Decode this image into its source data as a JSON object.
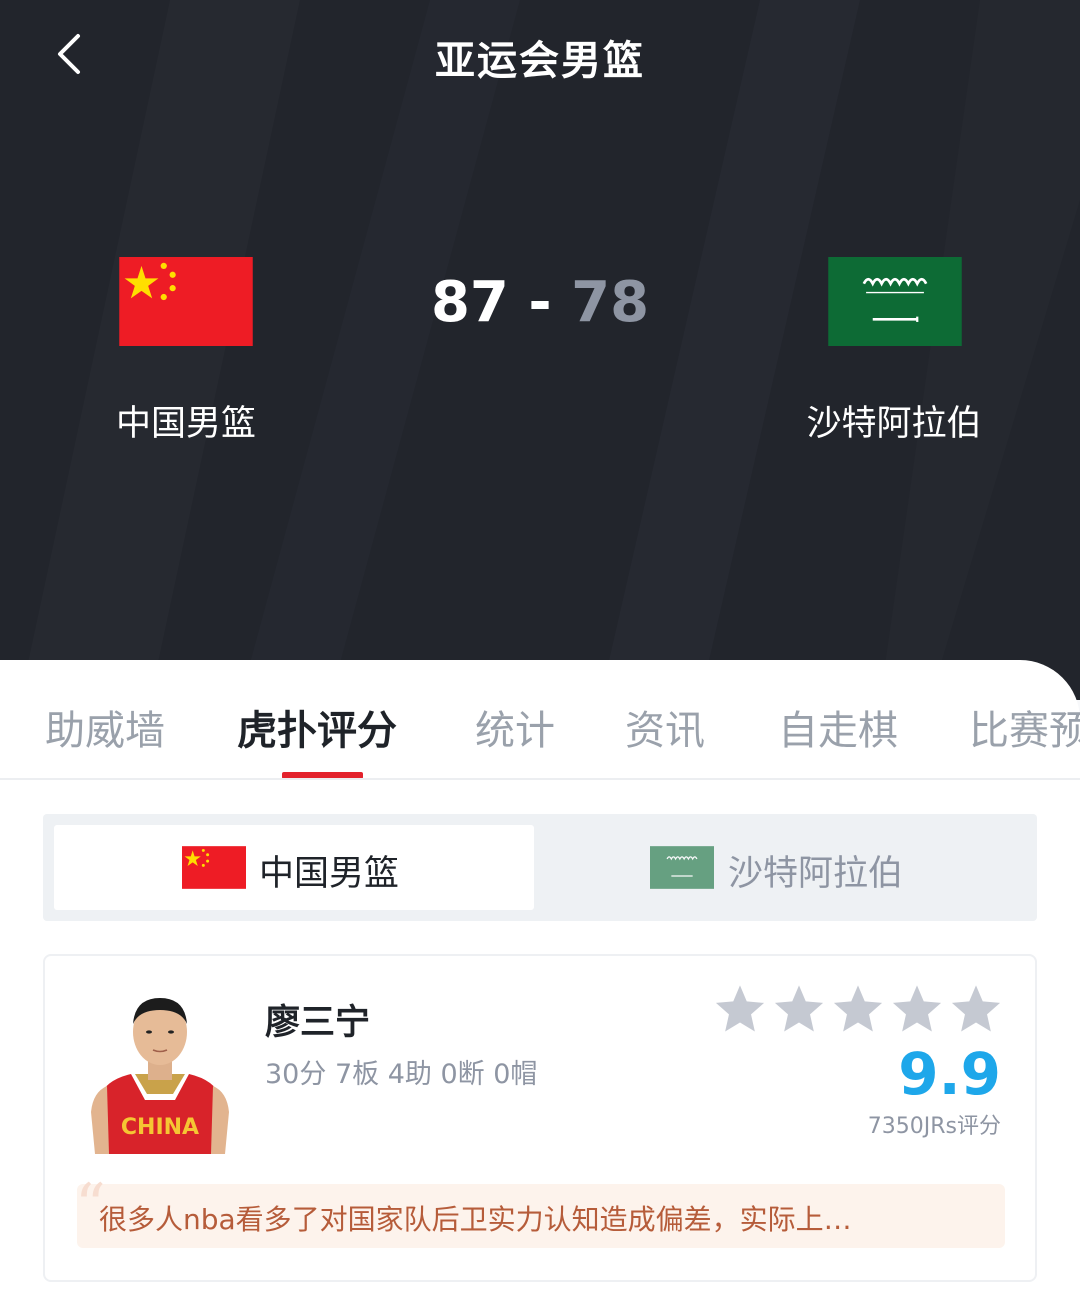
{
  "header": {
    "title": "亚运会男篮",
    "back_icon": "chevron-left-icon"
  },
  "match": {
    "home": {
      "name": "中国男篮",
      "score": "87",
      "flag": "china-flag"
    },
    "away": {
      "name": "沙特阿拉伯",
      "score": "78",
      "flag": "saudi-flag"
    },
    "separator": "-"
  },
  "tabs": [
    {
      "label": "助威墙",
      "active": false
    },
    {
      "label": "虎扑评分",
      "active": true
    },
    {
      "label": "统计",
      "active": false
    },
    {
      "label": "资讯",
      "active": false
    },
    {
      "label": "自走棋",
      "active": false
    },
    {
      "label": "比赛预",
      "active": false
    }
  ],
  "team_toggle": {
    "home_label": "中国男篮",
    "away_label": "沙特阿拉伯",
    "selected": "home"
  },
  "player": {
    "name": "廖三宁",
    "stats": "30分 7板 4助 0断 0帽",
    "rating": "9.9",
    "rating_count": "7350JRs评分",
    "stars": 5,
    "jersey_text": "CHINA",
    "comment": "很多人nba看多了对国家队后卫实力认知造成偏差，实际上…"
  },
  "colors": {
    "header_bg": "#22252c",
    "accent_red": "#e3222c",
    "rating_blue": "#1ea7ea",
    "comment_bg": "#fdf3ec",
    "comment_text": "#b65c3a",
    "away_score": "#8e95a3"
  }
}
